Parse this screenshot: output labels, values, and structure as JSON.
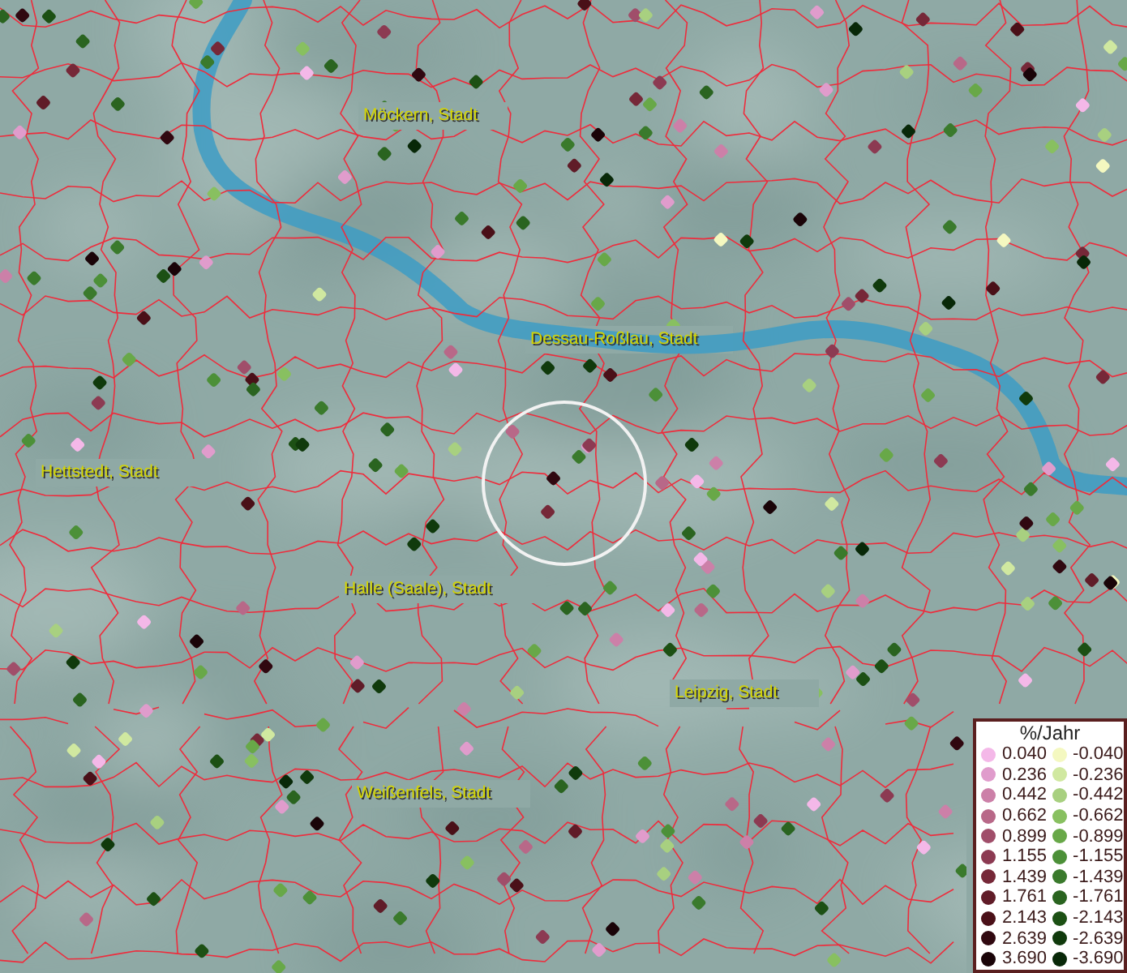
{
  "map": {
    "places": [
      {
        "name": "Möckern, Stadt"
      },
      {
        "name": "Dessau-Roßlau, Stadt"
      },
      {
        "name": "Hettstedt, Stadt"
      },
      {
        "name": "Halle (Saale), Stadt"
      },
      {
        "name": "Leipzig, Stadt"
      },
      {
        "name": "Weißenfels, Stadt"
      }
    ]
  },
  "legend": {
    "title": "%/Jahr",
    "positive_classes": [
      {
        "label": "0.040",
        "color": "#f4b8e8"
      },
      {
        "label": "0.236",
        "color": "#e09ccc"
      },
      {
        "label": "0.442",
        "color": "#cc80a8"
      },
      {
        "label": "0.662",
        "color": "#b86888"
      },
      {
        "label": "0.899",
        "color": "#a04e6a"
      },
      {
        "label": "1.155",
        "color": "#8c3a52"
      },
      {
        "label": "1.439",
        "color": "#762838"
      },
      {
        "label": "1.761",
        "color": "#601c28"
      },
      {
        "label": "2.143",
        "color": "#4a1018"
      },
      {
        "label": "2.639",
        "color": "#300810"
      },
      {
        "label": "3.690",
        "color": "#1a0408"
      }
    ],
    "negative_classes": [
      {
        "label": "-0.040",
        "color": "#f4f8c0"
      },
      {
        "label": "-0.236",
        "color": "#d0e8a0"
      },
      {
        "label": "-0.442",
        "color": "#a8d080"
      },
      {
        "label": "-0.662",
        "color": "#88c060"
      },
      {
        "label": "-0.899",
        "color": "#68a848"
      },
      {
        "label": "-1.155",
        "color": "#4c9038"
      },
      {
        "label": "-1.439",
        "color": "#3a7a2c"
      },
      {
        "label": "-1.761",
        "color": "#2a6420"
      },
      {
        "label": "-2.143",
        "color": "#1c5014"
      },
      {
        "label": "-2.639",
        "color": "#103a0c"
      },
      {
        "label": "-3.690",
        "color": "#082808"
      }
    ]
  }
}
